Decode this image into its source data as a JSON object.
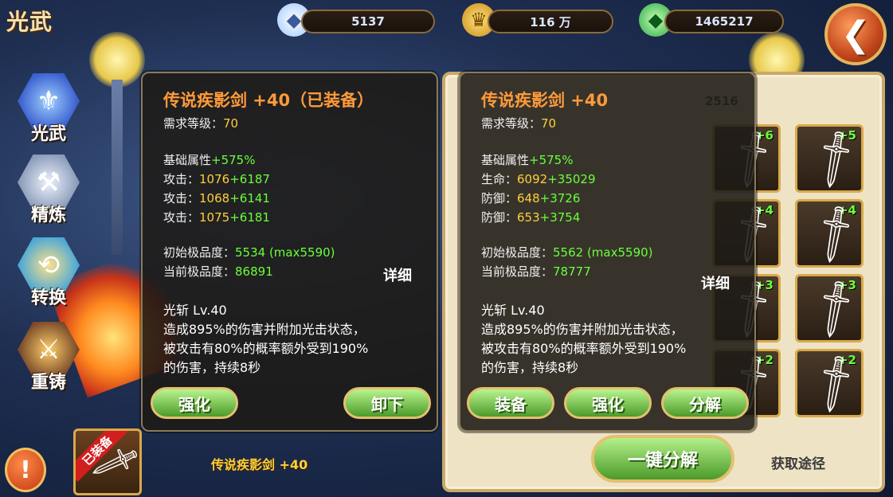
{
  "header": {
    "title": "光武",
    "diamonds": "5137",
    "gold": "116 万",
    "crystals": "1465217",
    "back_icon": "back-arrow-icon"
  },
  "nav": {
    "items": [
      {
        "label": "光武",
        "icon": "helmet-icon"
      },
      {
        "label": "精炼",
        "icon": "anvil-icon"
      },
      {
        "label": "转换",
        "icon": "swap-arrows-icon"
      },
      {
        "label": "重铸",
        "icon": "forge-hammer-icon"
      }
    ],
    "alert_label": "!"
  },
  "equipped": {
    "badge": "已装备",
    "item_name": "传说疾影剑 +40"
  },
  "inventory": {
    "gem_count": "2516",
    "slots": [
      {
        "plus": "+6"
      },
      {
        "plus": "+5"
      },
      {
        "plus": "+4"
      },
      {
        "plus": "+4"
      },
      {
        "plus": "+3"
      },
      {
        "plus": "+3"
      },
      {
        "plus": "+2"
      },
      {
        "plus": "+2"
      }
    ],
    "onekey_label": "一键分解",
    "source_label": "获取途径"
  },
  "tip_left": {
    "name": "传说疾影剑 +40（已装备）",
    "req_label": "需求等级：",
    "req_value": "70",
    "base_label": "基础属性",
    "base_bonus": "+575%",
    "stats": [
      {
        "label": "攻击：",
        "value": "1076",
        "bonus": "+6187"
      },
      {
        "label": "攻击：",
        "value": "1068",
        "bonus": "+6141"
      },
      {
        "label": "攻击：",
        "value": "1075",
        "bonus": "+6181"
      }
    ],
    "init_label": "初始极品度：",
    "init_value": "5534 (max5590)",
    "cur_label": "当前极品度：",
    "cur_value": "86891",
    "detail": "详细",
    "skill_name": "光斩 Lv.40",
    "skill_desc": [
      "造成895%的伤害并附加光击状态，",
      "被攻击有80%的概率额外受到190%",
      "的伤害，持续8秒"
    ],
    "btn_enhance": "强化",
    "btn_unequip": "卸下"
  },
  "tip_right": {
    "name": "传说疾影剑 +40",
    "req_label": "需求等级：",
    "req_value": "70",
    "base_label": "基础属性",
    "base_bonus": "+575%",
    "stats": [
      {
        "label": "生命：",
        "value": "6092",
        "bonus": "+35029"
      },
      {
        "label": "防御：",
        "value": "648",
        "bonus": "+3726"
      },
      {
        "label": "防御：",
        "value": "653",
        "bonus": "+3754"
      }
    ],
    "init_label": "初始极品度：",
    "init_value": "5562 (max5590)",
    "cur_label": "当前极品度：",
    "cur_value": "78777",
    "detail": "详细",
    "skill_name": "光斩 Lv.40",
    "skill_desc": [
      "造成895%的伤害并附加光击状态，",
      "被攻击有80%的概率额外受到190%",
      "的伤害，持续8秒"
    ],
    "btn_equip": "装备",
    "btn_enhance": "强化",
    "btn_decompose": "分解"
  }
}
